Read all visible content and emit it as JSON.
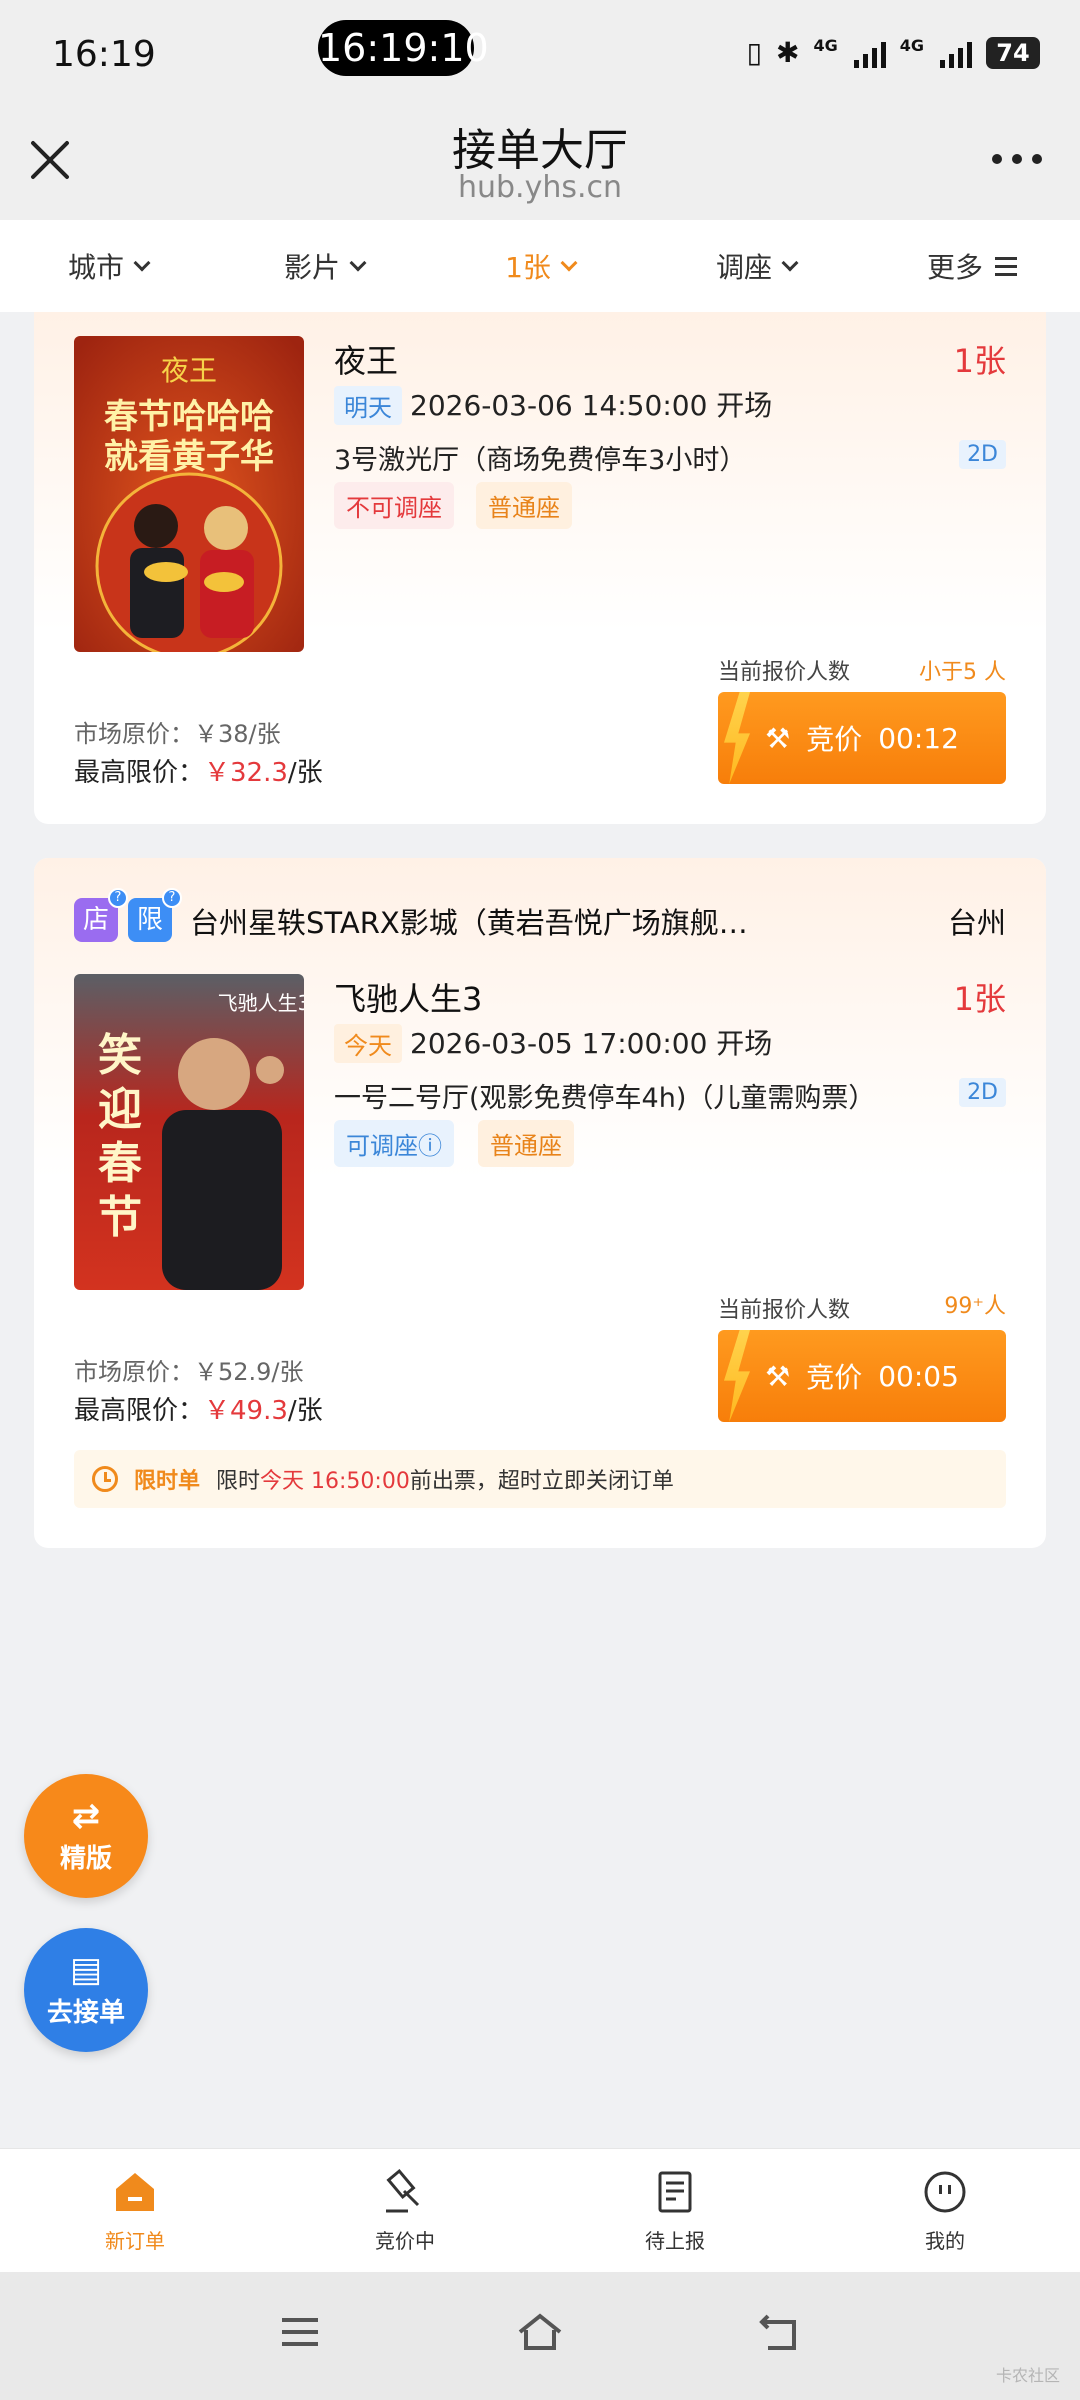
{
  "status_bar": {
    "time": "16:19",
    "clock_pill": "16:19:10",
    "network1": "4G",
    "network2": "4G",
    "battery": "74"
  },
  "nav": {
    "title": "接单大厅",
    "subtitle": "hub.yhs.cn"
  },
  "filters": [
    {
      "label": "城市",
      "active": false
    },
    {
      "label": "影片",
      "active": false
    },
    {
      "label": "1张",
      "active": true
    },
    {
      "label": "调座",
      "active": false
    },
    {
      "label": "更多",
      "active": false
    }
  ],
  "orders": [
    {
      "movie": "夜王",
      "count": "1张",
      "day_tag": "明天",
      "datetime": "2026-03-06 14:50:00 开场",
      "hall": "3号激光厅（商场免费停车3小时）",
      "format": "2D",
      "seat_adjust": "不可调座",
      "seat_type": "普通座",
      "bid_label": "当前报价人数",
      "bid_count": "小于5 人",
      "bid_button": "竞价",
      "bid_timer": "00:12",
      "market_price": "市场原价：￥38/张",
      "max_price_label": "最高限价：",
      "max_price_value": "￥32.3",
      "max_price_unit": "/张",
      "poster_text_top": "夜王",
      "poster_text_main1": "春节哈哈哈",
      "poster_text_main2": "就看黄子华"
    },
    {
      "store_badge": "店",
      "limit_badge": "限",
      "cinema": "台州星轶STARX影城（黄岩吾悦广场旗舰…",
      "city": "台州",
      "movie": "飞驰人生3",
      "count": "1张",
      "day_tag": "今天",
      "datetime": "2026-03-05 17:00:00 开场",
      "hall": "一号二号厅(观影免费停车4h)（儿童需购票）",
      "format": "2D",
      "seat_adjust": "可调座ⓘ",
      "seat_type": "普通座",
      "bid_label": "当前报价人数",
      "bid_count": "99⁺人",
      "bid_button": "竞价",
      "bid_timer": "00:05",
      "market_price": "市场原价：￥52.9/张",
      "max_price_label": "最高限价：",
      "max_price_value": "￥49.3",
      "max_price_unit": "/张",
      "limit_title": "限时单",
      "limit_prefix": "限时",
      "limit_time": "今天 16:50:00",
      "limit_suffix": "前出票，超时立即关闭订单",
      "poster_text_main": "笑迎春节",
      "poster_text_top": "飞驰人生3"
    }
  ],
  "fabs": {
    "lite": "精版",
    "go_orders": "去接单"
  },
  "tabs": [
    {
      "label": "新订单",
      "icon": "new-order-icon",
      "active": true
    },
    {
      "label": "竞价中",
      "icon": "gavel-icon",
      "active": false
    },
    {
      "label": "待上报",
      "icon": "report-icon",
      "active": false
    },
    {
      "label": "我的",
      "icon": "profile-face-icon",
      "active": false
    }
  ],
  "watermark": "卡农社区",
  "colors": {
    "accent": "#f08a1c",
    "price_red": "#e4393c",
    "tag_blue": "#3b86d8"
  }
}
